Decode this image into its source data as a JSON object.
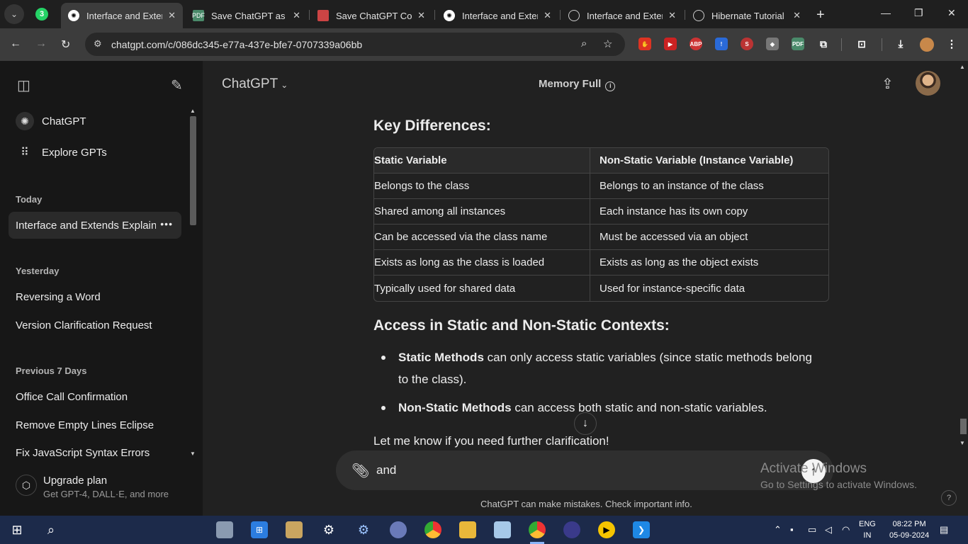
{
  "browser": {
    "tabs": [
      {
        "title": "Interface and Extends",
        "active": true
      },
      {
        "title": "Save ChatGPT as PDF"
      },
      {
        "title": "Save ChatGPT Conversation"
      },
      {
        "title": "Interface and Extends"
      },
      {
        "title": "Interface and Extends"
      },
      {
        "title": "Hibernate Tutorial"
      }
    ],
    "url": "chatgpt.com/c/086dc345-e77a-437e-bfe7-0707339a06bb"
  },
  "sidebar": {
    "nav": [
      {
        "label": "ChatGPT"
      },
      {
        "label": "Explore GPTs"
      }
    ],
    "today_heading": "Today",
    "today": [
      {
        "label": "Interface and Extends Explained"
      }
    ],
    "yesterday_heading": "Yesterday",
    "yesterday": [
      {
        "label": "Reversing a Word"
      },
      {
        "label": "Version Clarification Request"
      }
    ],
    "prev7_heading": "Previous 7 Days",
    "prev7": [
      {
        "label": "Office Call Confirmation"
      },
      {
        "label": "Remove Empty Lines Eclipse"
      },
      {
        "label": "Fix JavaScript Syntax Errors"
      }
    ],
    "upgrade_title": "Upgrade plan",
    "upgrade_sub": "Get GPT-4, DALL·E, and more"
  },
  "header": {
    "model": "ChatGPT",
    "memory": "Memory Full"
  },
  "message": {
    "heading1": "Key Differences:",
    "table": {
      "headers": [
        "Static Variable",
        "Non-Static Variable (Instance Variable)"
      ],
      "rows": [
        [
          "Belongs to the class",
          "Belongs to an instance of the class"
        ],
        [
          "Shared among all instances",
          "Each instance has its own copy"
        ],
        [
          "Can be accessed via the class name",
          "Must be accessed via an object"
        ],
        [
          "Exists as long as the class is loaded",
          "Exists as long as the object exists"
        ],
        [
          "Typically used for shared data",
          "Used for instance-specific data"
        ]
      ]
    },
    "heading2": "Access in Static and Non-Static Contexts:",
    "bullets": [
      {
        "bold": "Static Methods",
        "text": " can only access static variables (since static methods belong to the class)."
      },
      {
        "bold": "Non-Static Methods",
        "text": " can access both static and non-static variables."
      }
    ],
    "closing": "Let me know if you need further clarification!"
  },
  "composer": {
    "value": "and"
  },
  "disclaimer": "ChatGPT can make mistakes. Check important info.",
  "watermark": {
    "line1": "Activate Windows",
    "line2": "Go to Settings to activate Windows."
  },
  "taskbar": {
    "lang1": "ENG",
    "lang2": "IN",
    "time": "08:22 PM",
    "date": "05-09-2024"
  }
}
